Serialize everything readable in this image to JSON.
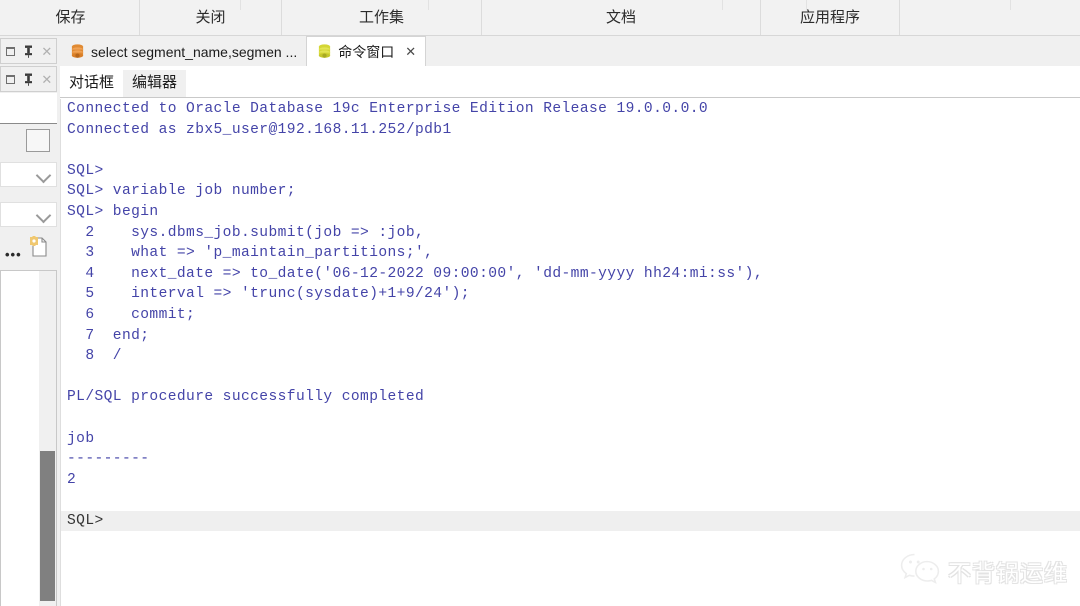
{
  "toolbar": {
    "items": [
      {
        "label": "保存",
        "name": "toolbar-save"
      },
      {
        "label": "关闭",
        "name": "toolbar-close"
      },
      {
        "label": "工作集",
        "name": "toolbar-workset"
      },
      {
        "label": "文档",
        "name": "toolbar-document"
      },
      {
        "label": "应用程序",
        "name": "toolbar-application"
      }
    ]
  },
  "sidebar": {
    "panel_controls": [
      {
        "restore": "❐",
        "pin": "📌",
        "close": "✕"
      },
      {
        "restore": "❐",
        "pin": "📌",
        "close": "✕"
      }
    ],
    "ellipsis_label": "•••"
  },
  "doc_tabs": [
    {
      "label": "select segment_name,segmen ...",
      "icon": "database-icon-orange",
      "active": false,
      "closable": false
    },
    {
      "label": "命令窗口",
      "icon": "database-icon-yellow",
      "active": true,
      "closable": true,
      "close_label": "✕"
    }
  ],
  "sub_tabs": [
    {
      "label": "对话框",
      "active": true
    },
    {
      "label": "编辑器",
      "active": false
    }
  ],
  "terminal": {
    "lines": [
      {
        "text": "Connected to Oracle Database 19c Enterprise Edition Release 19.0.0.0.0",
        "style": "output"
      },
      {
        "text": "Connected as zbx5_user@192.168.11.252/pdb1",
        "style": "output"
      },
      {
        "text": "",
        "style": "blank"
      },
      {
        "text": "SQL>",
        "style": "output"
      },
      {
        "text": "SQL> variable job number;",
        "style": "output"
      },
      {
        "text": "SQL> begin",
        "style": "output"
      },
      {
        "text": "  2    sys.dbms_job.submit(job => :job,",
        "style": "output"
      },
      {
        "text": "  3    what => 'p_maintain_partitions;',",
        "style": "output"
      },
      {
        "text": "  4    next_date => to_date('06-12-2022 09:00:00', 'dd-mm-yyyy hh24:mi:ss'),",
        "style": "output"
      },
      {
        "text": "  5    interval => 'trunc(sysdate)+1+9/24');",
        "style": "output"
      },
      {
        "text": "  6    commit;",
        "style": "output"
      },
      {
        "text": "  7  end;",
        "style": "output"
      },
      {
        "text": "  8  /",
        "style": "output"
      },
      {
        "text": "",
        "style": "blank"
      },
      {
        "text": "PL/SQL procedure successfully completed",
        "style": "output"
      },
      {
        "text": "",
        "style": "blank"
      },
      {
        "text": "job",
        "style": "output"
      },
      {
        "text": "---------",
        "style": "output"
      },
      {
        "text": "2",
        "style": "output"
      },
      {
        "text": "",
        "style": "blank"
      },
      {
        "text": "SQL>",
        "style": "prompt-active"
      }
    ]
  },
  "watermark": {
    "text": "不背锅运维",
    "icon": "wechat-icon"
  },
  "colors": {
    "terminal_text": "#4444a8",
    "toolbar_bg": "#f2f2f2",
    "active_tab_bg": "#ffffff",
    "inactive_tab_bg": "#f0f0f0",
    "prompt_highlight_bg": "#efefef",
    "db_icon_orange": "#e08a33",
    "db_icon_yellow": "#d4d636",
    "scrollbar_thumb": "#808080"
  }
}
